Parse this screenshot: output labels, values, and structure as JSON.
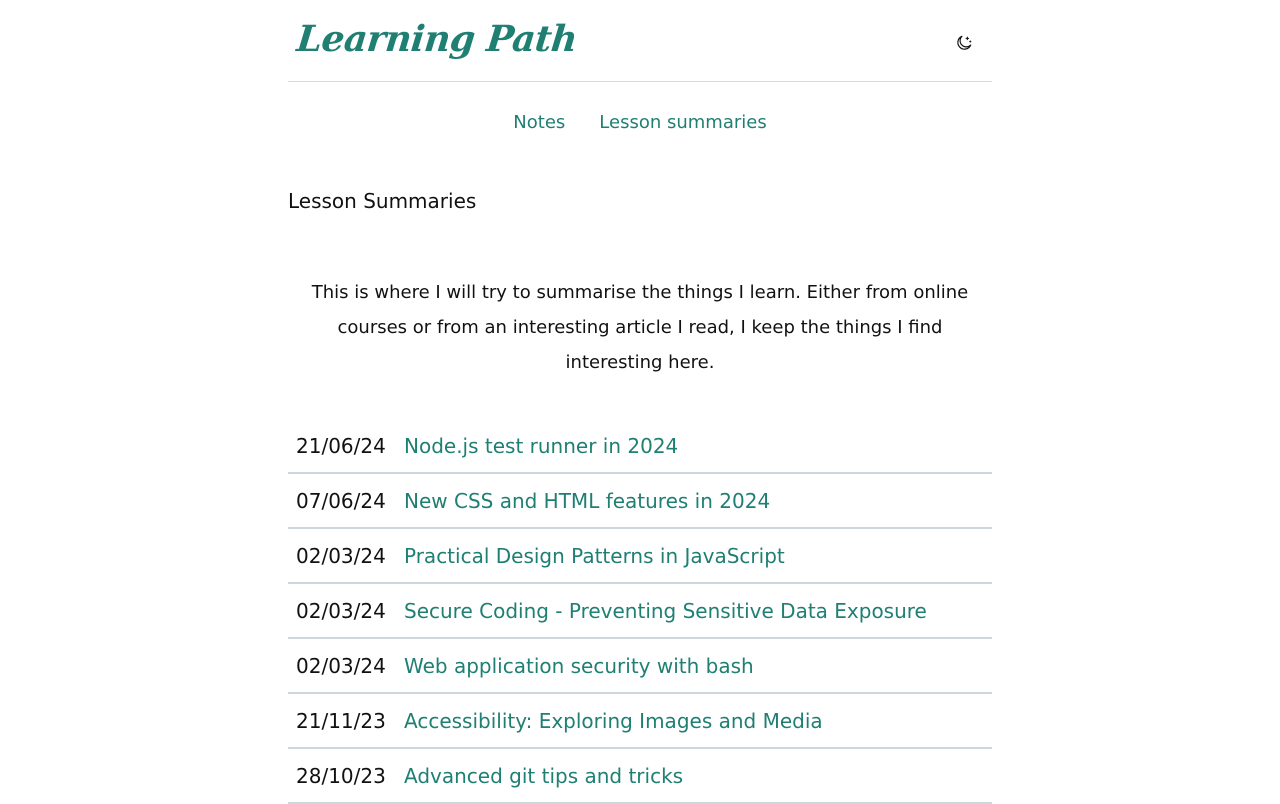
{
  "header": {
    "site_title": "Learning Path",
    "theme_toggle_icon": "moon-icon"
  },
  "nav": {
    "items": [
      {
        "label": "Notes"
      },
      {
        "label": "Lesson summaries"
      }
    ]
  },
  "main": {
    "title": "Lesson Summaries",
    "intro": "This is where I will try to summarise the things I learn. Either from online courses or from an interesting article I read, I keep the things I find interesting here.",
    "summaries": [
      {
        "date": "21/06/24",
        "title": "Node.js test runner in 2024"
      },
      {
        "date": "07/06/24",
        "title": "New CSS and HTML features in 2024"
      },
      {
        "date": "02/03/24",
        "title": "Practical Design Patterns in JavaScript"
      },
      {
        "date": "02/03/24",
        "title": "Secure Coding - Preventing Sensitive Data Exposure"
      },
      {
        "date": "02/03/24",
        "title": "Web application security with bash"
      },
      {
        "date": "21/11/23",
        "title": "Accessibility: Exploring Images and Media"
      },
      {
        "date": "28/10/23",
        "title": "Advanced git tips and tricks"
      }
    ]
  },
  "colors": {
    "accent": "#1f7f73",
    "divider": "#ced6e0",
    "text": "#111111"
  }
}
